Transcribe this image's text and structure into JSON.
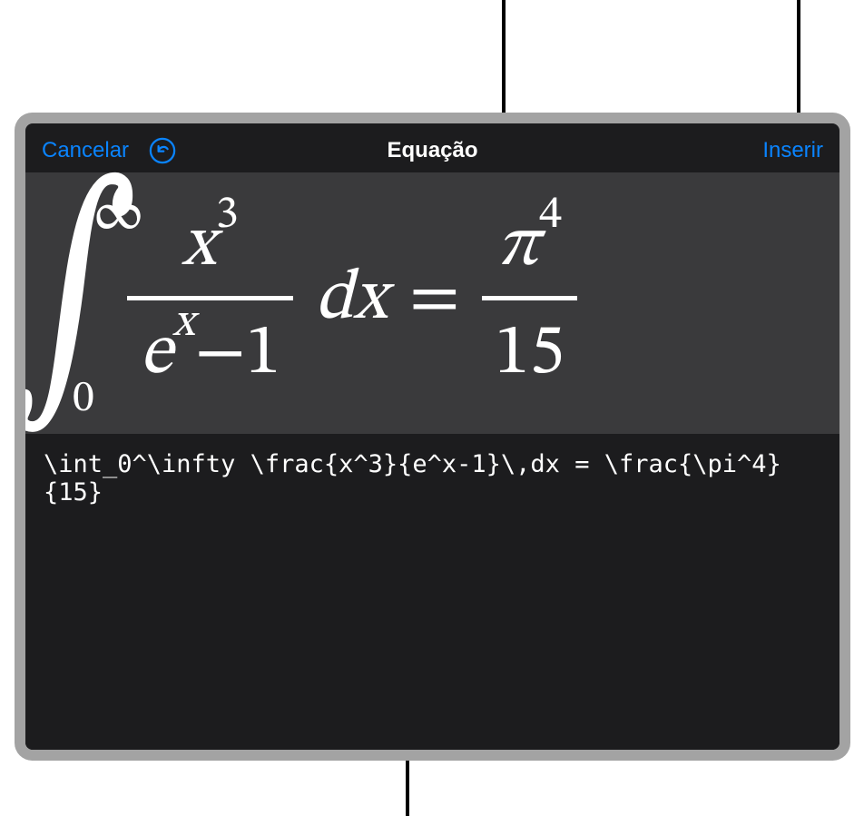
{
  "header": {
    "cancel_label": "Cancelar",
    "title": "Equação",
    "insert_label": "Inserir"
  },
  "equation": {
    "int_lower": "0",
    "int_upper": "∞",
    "num_base": "x",
    "num_exp": "3",
    "den_base": "e",
    "den_exp": "x",
    "den_minus": "−",
    "den_const": "1",
    "diff": "dx",
    "equals": "=",
    "rhs_num_base": "π",
    "rhs_num_exp": "4",
    "rhs_den": "15"
  },
  "input": {
    "latex": "\\int_0^\\infty \\frac{x^3}{e^x-1}\\,dx = \\frac{\\pi^4}{15}"
  }
}
